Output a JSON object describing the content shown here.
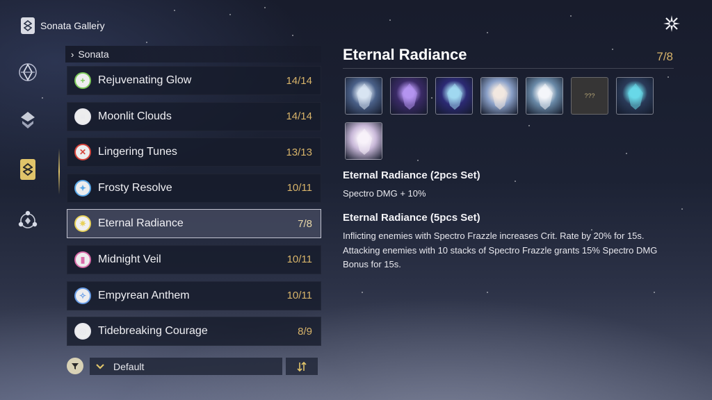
{
  "header": {
    "title": "Sonata Gallery",
    "icon": "sonata-book-icon"
  },
  "close": {
    "icon": "close-star-icon"
  },
  "rail": [
    {
      "id": "echo",
      "icon": "echo-crystal-icon",
      "active": false
    },
    {
      "id": "phantom",
      "icon": "layered-chevron-icon",
      "active": false
    },
    {
      "id": "sonata",
      "icon": "sonata-tab-icon",
      "active": true
    },
    {
      "id": "network",
      "icon": "node-network-icon",
      "active": false
    }
  ],
  "list": {
    "header": "Sonata",
    "items": [
      {
        "name": "Rejuvenating Glow",
        "count": "14/14",
        "color": "#7cc95a",
        "glyph": "+"
      },
      {
        "name": "Moonlit Clouds",
        "count": "14/14",
        "color": "#e8e8ee",
        "glyph": "≡"
      },
      {
        "name": "Lingering Tunes",
        "count": "13/13",
        "color": "#d6453c",
        "glyph": "✕"
      },
      {
        "name": "Frosty Resolve",
        "count": "10/11",
        "color": "#5aa8e8",
        "glyph": "✦"
      },
      {
        "name": "Eternal Radiance",
        "count": "7/8",
        "color": "#e8d25a",
        "glyph": "✷",
        "selected": true
      },
      {
        "name": "Midnight Veil",
        "count": "10/11",
        "color": "#d86aa8",
        "glyph": "▮"
      },
      {
        "name": "Empyrean Anthem",
        "count": "10/11",
        "color": "#6a9ee8",
        "glyph": "✧"
      },
      {
        "name": "Tidebreaking Courage",
        "count": "8/9",
        "color": "#e8e8ee",
        "glyph": "◎"
      }
    ]
  },
  "sort": {
    "label": "Default",
    "filter_icon": "filter-funnel-icon",
    "order_icon": "sort-order-icon"
  },
  "detail": {
    "title": "Eternal Radiance",
    "count": "7/8",
    "echoes": [
      {
        "name": "wolf-echo-icon",
        "base": "#4a6088",
        "accent": "#d8e4f2"
      },
      {
        "name": "violet-bird-echo-icon",
        "base": "#3a2a66",
        "accent": "#b494f0"
      },
      {
        "name": "winged-eye-echo-icon",
        "base": "#2c2a74",
        "accent": "#a0d8f0"
      },
      {
        "name": "bear-echo-icon",
        "base": "#8aa0c8",
        "accent": "#f2e8e0"
      },
      {
        "name": "white-bird-echo-icon",
        "base": "#6a8aa8",
        "accent": "#f4f6fa"
      },
      {
        "name": "unknown-echo-icon",
        "text": "???"
      },
      {
        "name": "hat-figure-echo-icon",
        "base": "#2a3a58",
        "accent": "#68d8e8"
      },
      {
        "name": "crystal-mask-echo-icon",
        "base": "#c8b8d8",
        "accent": "#f8f2fa"
      }
    ],
    "set2": {
      "title": "Eternal Radiance (2pcs Set)",
      "desc": "Spectro DMG + 10%"
    },
    "set5": {
      "title": "Eternal Radiance (5pcs Set)",
      "desc": "Inflicting enemies with Spectro Frazzle increases Crit. Rate by 20% for 15s. Attacking enemies with 10 stacks of Spectro Frazzle grants 15% Spectro DMG Bonus for 15s."
    }
  }
}
